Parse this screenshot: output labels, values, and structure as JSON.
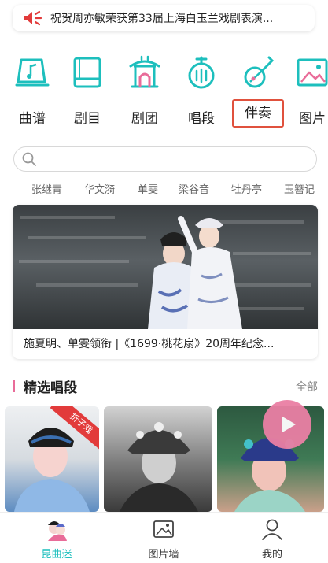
{
  "announcement": {
    "icon": "speaker-icon",
    "text": "祝贺周亦敏荣获第33届上海白玉兰戏剧表演..."
  },
  "categories": [
    {
      "label": "曲谱",
      "icon": "music-score-icon"
    },
    {
      "label": "剧目",
      "icon": "book-icon"
    },
    {
      "label": "剧团",
      "icon": "theater-pavilion-icon"
    },
    {
      "label": "唱段",
      "icon": "instrument-drum-icon"
    },
    {
      "label": "伴奏",
      "icon": "pipa-icon",
      "selected": true
    },
    {
      "label": "图片",
      "icon": "picture-icon"
    }
  ],
  "search": {
    "placeholder": ""
  },
  "tags": [
    "张继青",
    "华文漪",
    "单雯",
    "梁谷音",
    "牡丹亭",
    "玉簪记"
  ],
  "banner": {
    "caption": "施夏明、单雯领衔 |《1699·桃花扇》20周年纪念..."
  },
  "section": {
    "title": "精选唱段",
    "more": "全部"
  },
  "thumbnails": [
    {
      "badge": "折子戏"
    },
    {
      "badge": ""
    },
    {
      "badge": ""
    }
  ],
  "bottom_nav": [
    {
      "label": "昆曲迷",
      "icon": "kunqu-fan-icon",
      "active": true
    },
    {
      "label": "图片墙",
      "icon": "photo-wall-icon",
      "active": false
    },
    {
      "label": "我的",
      "icon": "person-icon",
      "active": false
    }
  ],
  "colors": {
    "accent": "#1dbfbd",
    "highlight_border": "#e0513d",
    "pink": "#e96c99",
    "speaker_red": "#e23b3b"
  }
}
